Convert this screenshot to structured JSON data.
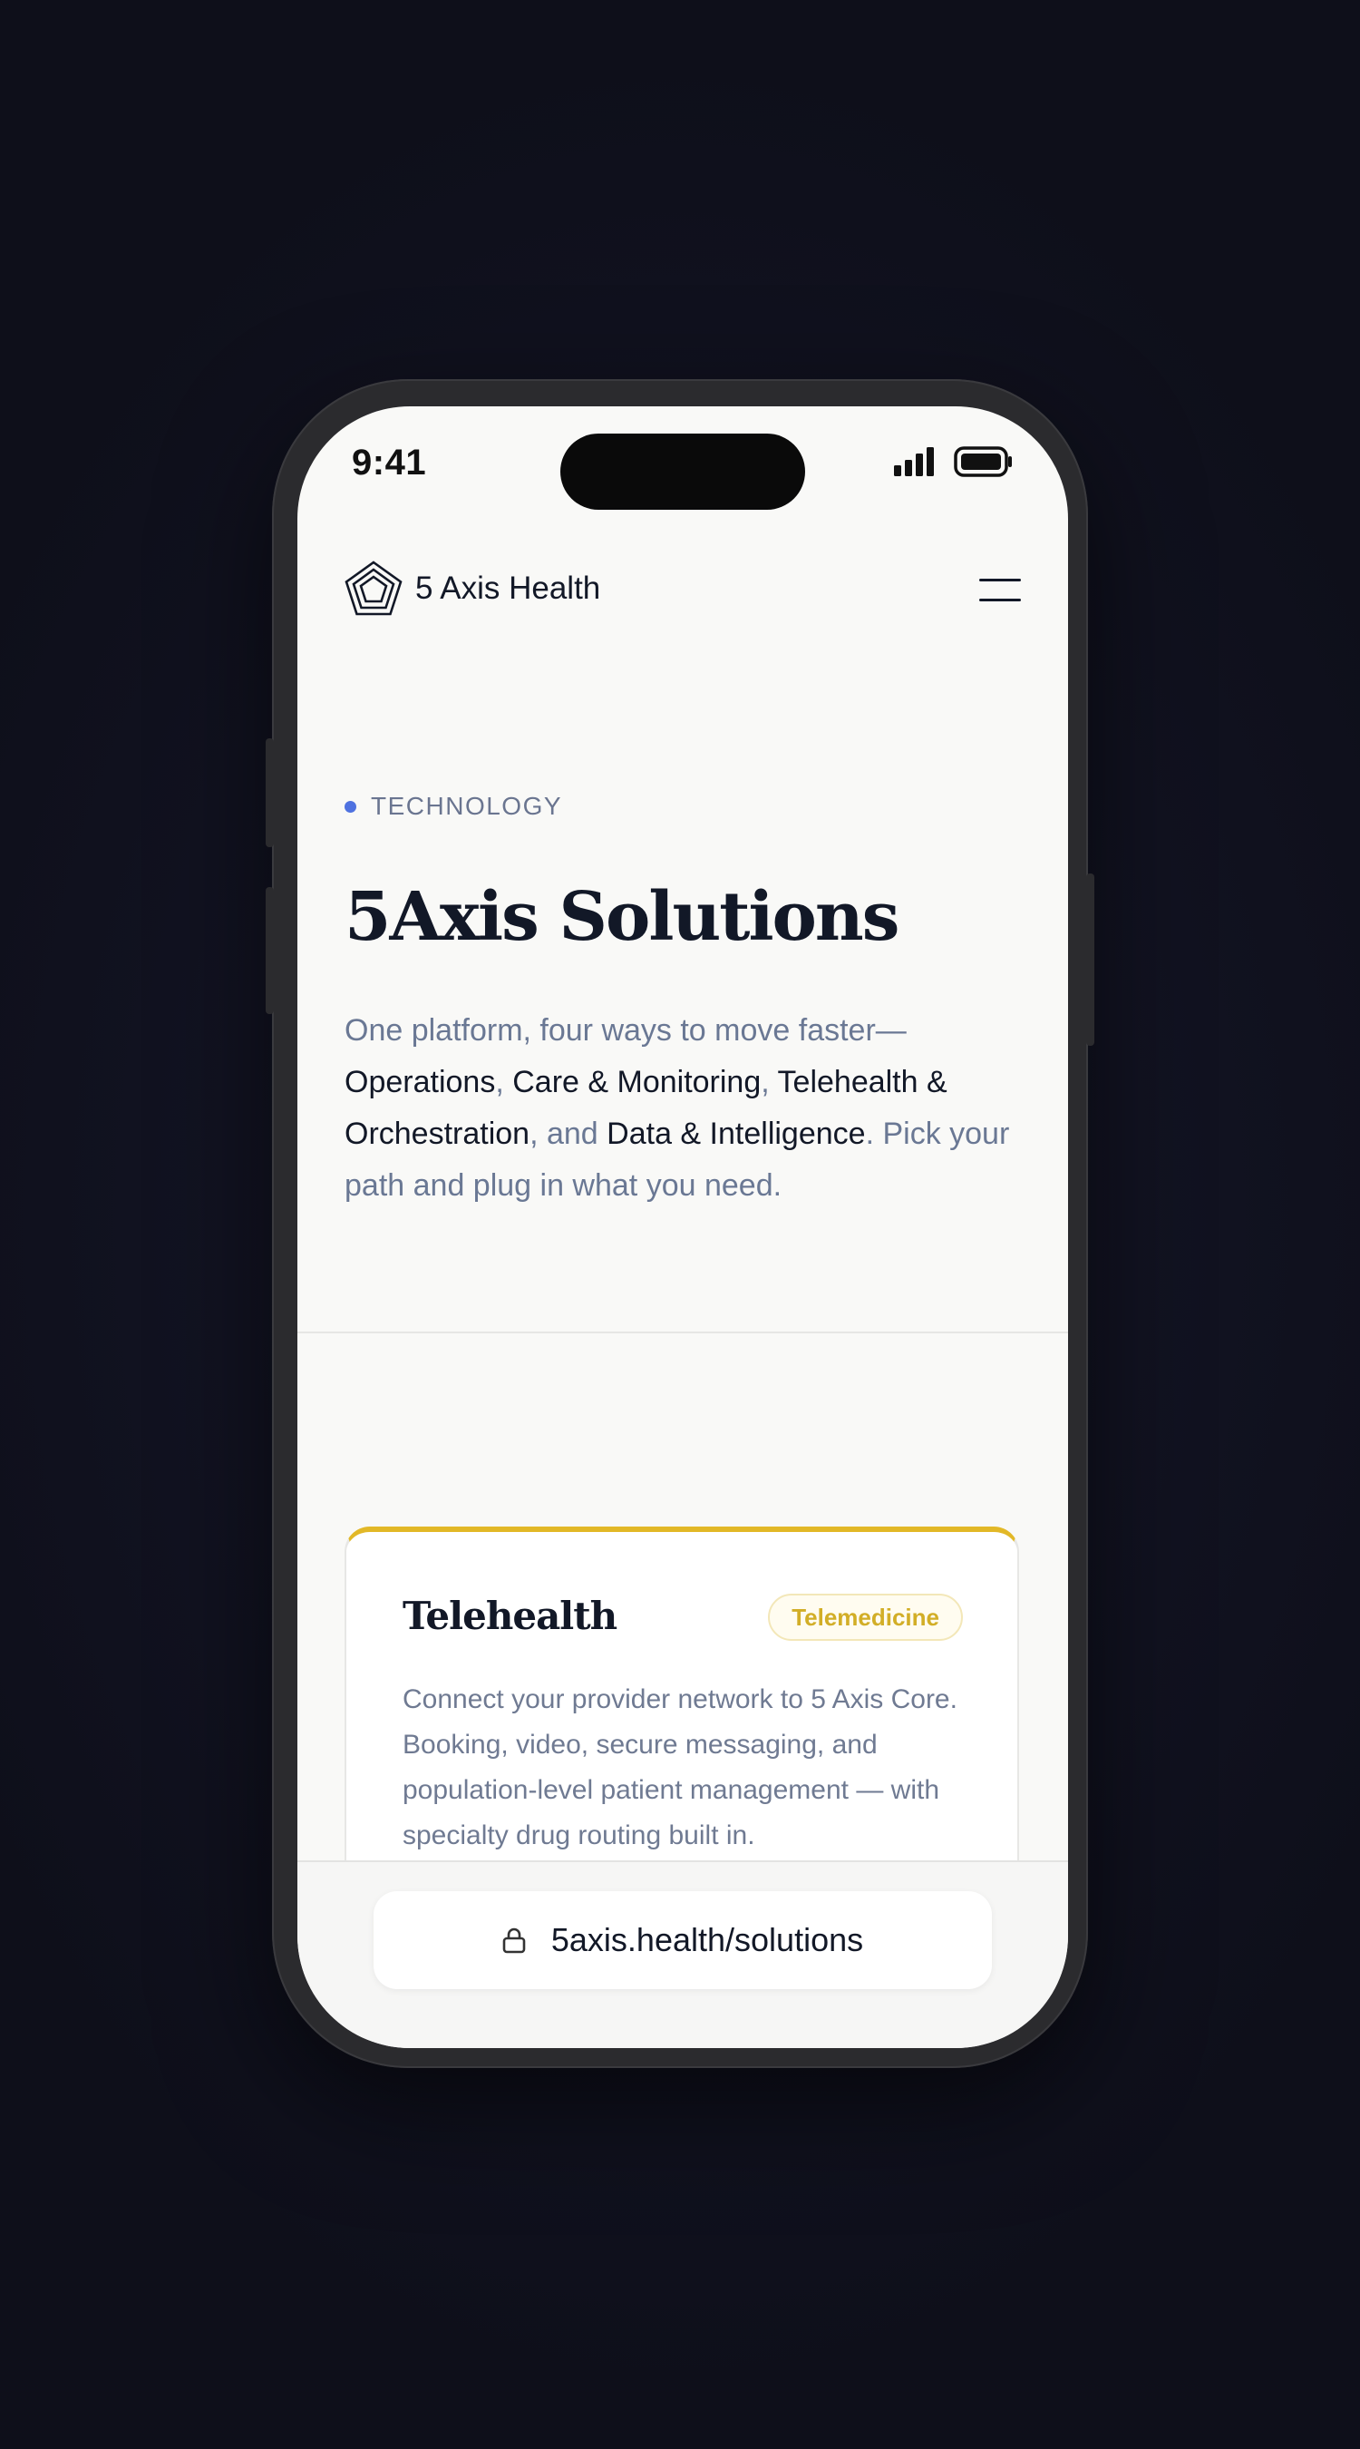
{
  "status_bar": {
    "time": "9:41",
    "icons": [
      "cellular-signal-icon",
      "battery-icon"
    ]
  },
  "header": {
    "brand": "5 Axis Health",
    "logo_icon": "pentagon-logo-icon",
    "menu_icon": "hamburger-menu-icon"
  },
  "hero": {
    "eyebrow": "TECHNOLOGY",
    "title": "5Axis Solutions",
    "desc_intro": "One platform, four ways to move faster—",
    "desc_item_1": "Operations",
    "desc_sep_1": ", ",
    "desc_item_2": "Care & Monitoring",
    "desc_sep_2": ", ",
    "desc_item_3": "Telehealth & Orchestration",
    "desc_sep_3": ", and ",
    "desc_item_4": "Data & Intelligence",
    "desc_outro": ". Pick your path and plug in what you need."
  },
  "card": {
    "title": "Telehealth",
    "badge": "Telemedicine",
    "text": "Connect your provider network to 5 Axis Core. Booking, video, secure messaging, and population-level patient management — with specialty drug routing built in.",
    "accent_color": "#e2b827"
  },
  "browser": {
    "url": "5axis.health/solutions",
    "lock_icon": "lock-icon"
  },
  "colors": {
    "accent_dot": "#4f72e0",
    "ink": "#121827",
    "muted": "#6a7894",
    "badge_text": "#d2ae27"
  }
}
